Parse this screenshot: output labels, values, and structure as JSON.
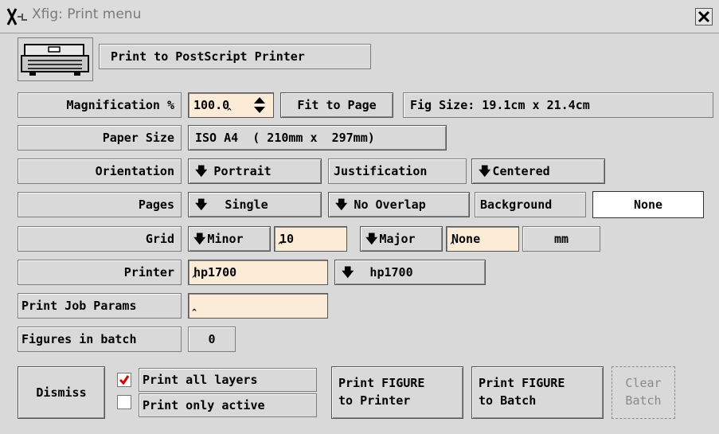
{
  "window": {
    "title": "Xfig: Print menu"
  },
  "header": {
    "print_to": "Print to PostScript Printer"
  },
  "magnification": {
    "label": "Magnification %",
    "value": "100.0",
    "fit_button": "Fit to Page",
    "fig_size": "Fig Size: 19.1cm x 21.4cm"
  },
  "paper_size": {
    "label": "Paper Size",
    "value": "ISO A4  ( 210mm x  297mm)"
  },
  "orientation": {
    "label": "Orientation",
    "value": "Portrait",
    "justification_label": "Justification",
    "justification_value": "Centered"
  },
  "pages": {
    "label": "Pages",
    "value": "Single",
    "overlap": "No Overlap",
    "background_label": "Background",
    "background_value": "None"
  },
  "grid": {
    "label": "Grid",
    "minor_button": "Minor",
    "minor_value": "10",
    "major_button": "Major",
    "major_value": "None",
    "units": "mm"
  },
  "printer": {
    "label": "Printer",
    "value": "hp1700",
    "menu_value": "hp1700"
  },
  "job_params": {
    "label": "Print Job Params",
    "value": ""
  },
  "batch": {
    "label": "Figures in batch",
    "count": "0"
  },
  "actions": {
    "dismiss": "Dismiss",
    "all_layers": "Print all layers",
    "active_layer": "Print only active",
    "all_layers_checked": true,
    "print_printer_line1": "Print FIGURE",
    "print_printer_line2": "to Printer",
    "print_batch_line1": "Print FIGURE",
    "print_batch_line2": "to Batch",
    "clear_line1": "Clear",
    "clear_line2": "Batch"
  },
  "icons": {
    "menu_arrow": "down-arrow-icon",
    "check": "check-icon",
    "close": "close-icon",
    "printer": "printer-icon"
  }
}
